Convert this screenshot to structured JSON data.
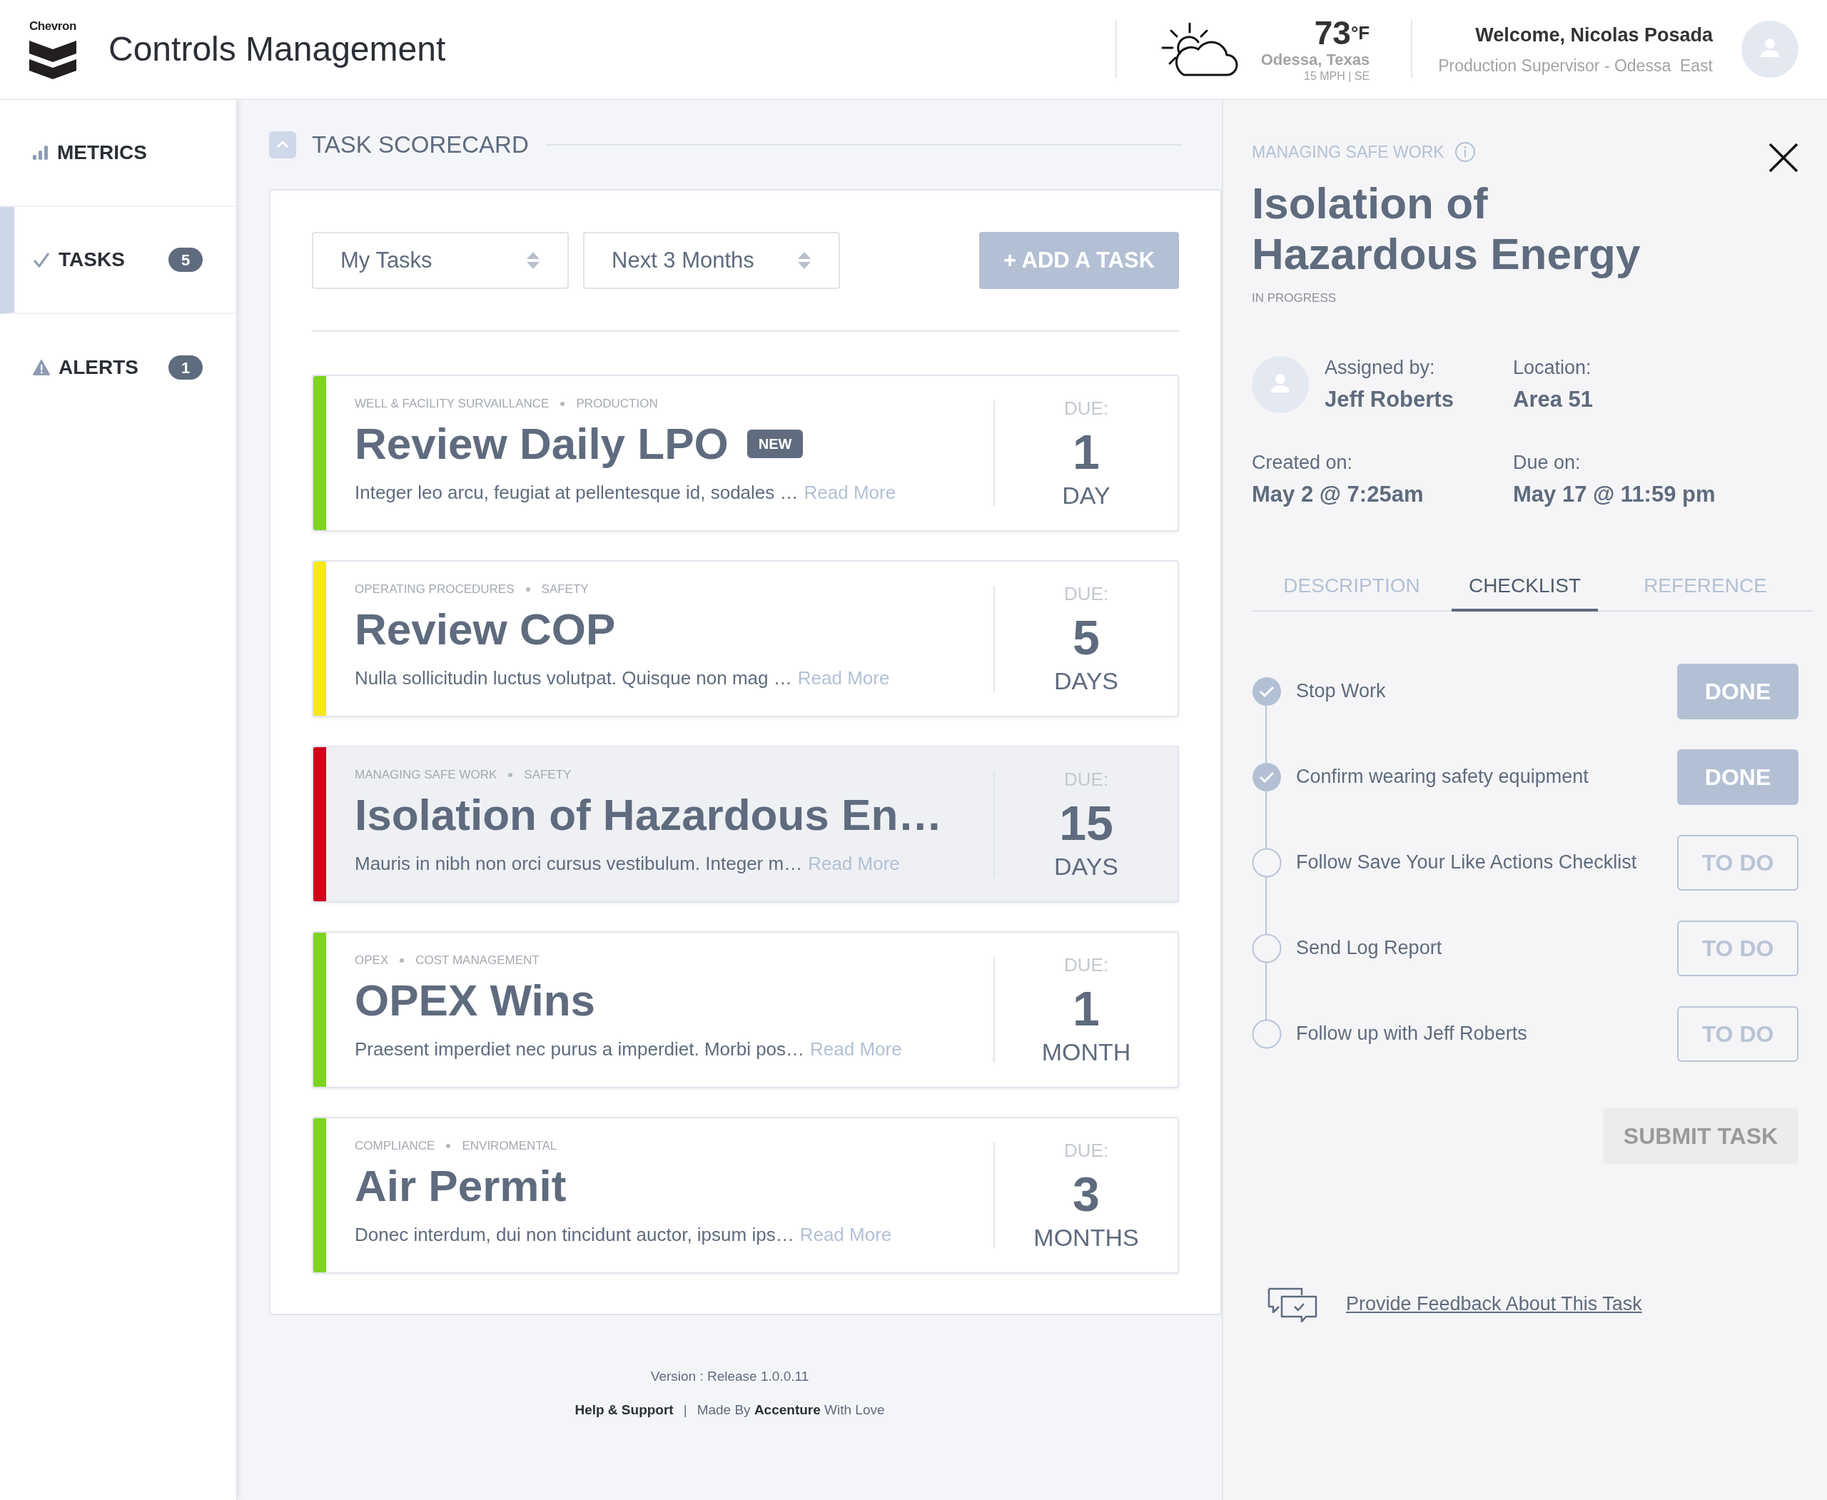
{
  "header": {
    "logo_text": "Chevron",
    "title": "Controls Management",
    "weather": {
      "temperature": "73",
      "unit": "°F",
      "city": "Odessa, Texas",
      "wind": "15 MPH | SE"
    },
    "user": {
      "greeting": "Welcome, Nicolas Posada",
      "role": "Production Supervisor - Odessa  East"
    }
  },
  "sidebar": {
    "items": [
      {
        "kind": "metrics",
        "label": "METRICS",
        "selected": false
      },
      {
        "kind": "tasks",
        "label": "TASKS",
        "badge": "5",
        "selected": true
      },
      {
        "kind": "alerts",
        "label": "ALERTS",
        "badge": "1",
        "selected": false
      }
    ]
  },
  "scorecard": {
    "title": "TASK SCORECARD",
    "filters": [
      {
        "value": "My Tasks"
      },
      {
        "value": "Next 3 Months"
      }
    ],
    "add_button": "+ ADD A TASK",
    "tasks": [
      {
        "category": "WELL & FACILITY SURVAILLANCE",
        "tag": "PRODUCTION",
        "title": "Review Daily LPO",
        "badge": "NEW",
        "description": "Integer leo arcu, feugiat at pellentesque id, sodales …",
        "link": "Read More",
        "due_label": "DUE:",
        "due_value": "1",
        "due_unit": "DAY",
        "color": "#7ed321",
        "selected": false
      },
      {
        "category": "OPERATING PROCEDURES",
        "tag": "SAFETY",
        "title": "Review COP",
        "description": "Nulla sollicitudin luctus volutpat. Quisque non mag …",
        "link": "Read More",
        "due_label": "DUE:",
        "due_value": "5",
        "due_unit": "DAYS",
        "color": "#f8e71c",
        "selected": false
      },
      {
        "category": "MANAGING SAFE WORK",
        "tag": "SAFETY",
        "title": "Isolation of Hazardous En…",
        "description": "Mauris in nibh non orci cursus vestibulum. Integer m…",
        "link": "Read More",
        "due_label": "DUE:",
        "due_value": "15",
        "due_unit": "DAYS",
        "color": "#d0021b",
        "selected": true
      },
      {
        "category": "OPEX",
        "tag": "COST MANAGEMENT",
        "title": "OPEX Wins",
        "description": "Praesent imperdiet nec purus a imperdiet. Morbi pos…",
        "link": "Read More",
        "due_label": "DUE:",
        "due_value": "1",
        "due_unit": "MONTH",
        "color": "#7ed321",
        "selected": false
      },
      {
        "category": "COMPLIANCE",
        "tag": "ENVIROMENTAL",
        "title": "Air Permit",
        "description": "Donec interdum, dui non tincidunt auctor, ipsum ips…",
        "link": "Read More",
        "due_label": "DUE:",
        "due_value": "3",
        "due_unit": "MONTHS",
        "color": "#7ed321",
        "selected": false
      }
    ]
  },
  "footer": {
    "version": "Version : Release 1.0.0.11",
    "help": "Help & Support",
    "separator": "|",
    "credit": "Made By **Accenture** With Love"
  },
  "detail": {
    "category": "MANAGING SAFE WORK",
    "title": "Isolation of Hazardous Energy",
    "status": "IN PROGRESS",
    "facts": [
      {
        "label": "Assigned by:",
        "value": "Jeff Roberts",
        "kind": "person"
      },
      {
        "label": "Location:",
        "value": "Area 51",
        "kind": "plain"
      },
      {
        "label": "Created on:",
        "value": "May 2 @ 7:25am",
        "kind": "plain"
      },
      {
        "label": "Due on:",
        "value": "May 17 @ 11:59 pm",
        "kind": "plain"
      }
    ],
    "tabs": [
      {
        "label": "DESCRIPTION",
        "selected": false
      },
      {
        "label": "CHECKLIST",
        "selected": true
      },
      {
        "label": "REFERENCE",
        "selected": false
      }
    ],
    "checklist": [
      {
        "label": "Stop Work",
        "done": true,
        "action": "DONE"
      },
      {
        "label": "Confirm wearing safety equipment",
        "done": true,
        "action": "DONE"
      },
      {
        "label": "Follow Save Your Like Actions Checklist",
        "done": false,
        "action": "TO DO"
      },
      {
        "label": "Send Log Report",
        "done": false,
        "action": "TO DO"
      },
      {
        "label": "Follow up with Jeff Roberts",
        "done": false,
        "action": "TO DO"
      }
    ],
    "submit_button": "SUBMIT TASK",
    "feedback_link": "Provide Feedback About This Task"
  }
}
